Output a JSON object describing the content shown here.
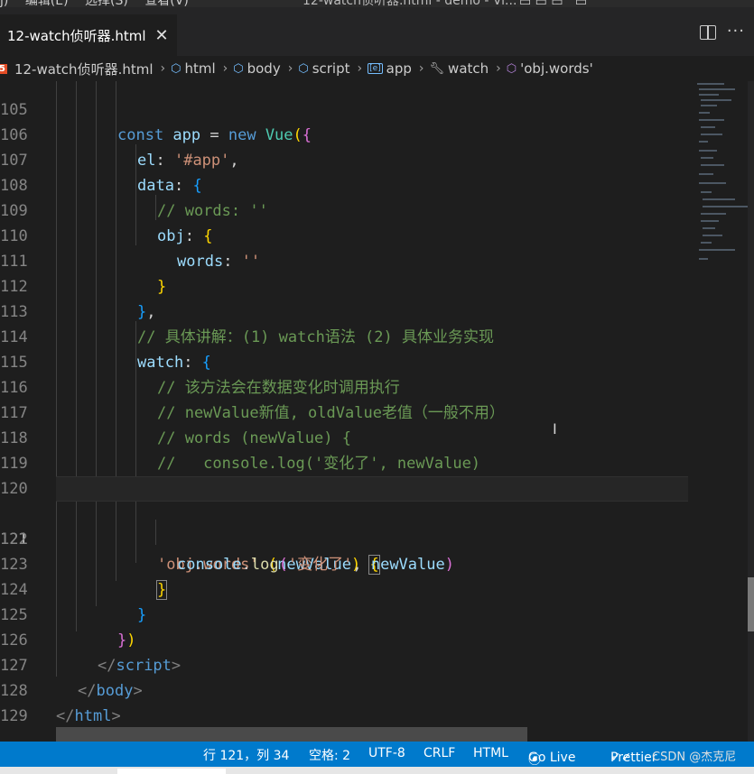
{
  "menubar": {
    "items": [
      "j)",
      "编辑(E)",
      "选择(S)",
      "查看(V)"
    ],
    "window_title": "12-watch侦听器.html - demo - Vi..."
  },
  "tab": {
    "label": "12-watch侦听器.html",
    "close": "✕"
  },
  "breadcrumb": {
    "file": "12-watch侦听器.html",
    "items": [
      "html",
      "body",
      "script",
      "app",
      "watch",
      "'obj.words'"
    ]
  },
  "editor": {
    "current_line": "121",
    "lines": [
      {
        "n": "105"
      },
      {
        "n": "106"
      },
      {
        "n": "107"
      },
      {
        "n": "108"
      },
      {
        "n": "109"
      },
      {
        "n": "110"
      },
      {
        "n": "111"
      },
      {
        "n": "112"
      },
      {
        "n": "113"
      },
      {
        "n": "114"
      },
      {
        "n": "115"
      },
      {
        "n": "116"
      },
      {
        "n": "117"
      },
      {
        "n": "118"
      },
      {
        "n": "119"
      },
      {
        "n": "120"
      },
      {
        "n": "121"
      },
      {
        "n": "122"
      },
      {
        "n": "123"
      },
      {
        "n": "124"
      },
      {
        "n": "125"
      },
      {
        "n": "126"
      },
      {
        "n": "127"
      },
      {
        "n": "128"
      },
      {
        "n": "129"
      }
    ],
    "tokens": {
      "l105": [
        "const",
        " app ",
        "=",
        " new ",
        "Vue",
        "(",
        "{"
      ],
      "l106": [
        "el",
        ": ",
        "'#app'",
        ","
      ],
      "l107": [
        "data",
        ": ",
        "{"
      ],
      "l108": [
        "// words: ''"
      ],
      "l109": [
        "obj",
        ": ",
        "{"
      ],
      "l110": [
        "words",
        ": ",
        "''"
      ],
      "l111": [
        "}"
      ],
      "l112": [
        "}",
        ","
      ],
      "l113": [
        "// 具体讲解：(1) watch语法 (2) 具体业务实现"
      ],
      "l114": [
        "watch",
        ": ",
        "{"
      ],
      "l115": [
        "// 该方法会在数据变化时调用执行"
      ],
      "l116": [
        "// newValue新值, oldValue老值（一般不用）"
      ],
      "l117": [
        "// words (newValue) {"
      ],
      "l118": [
        "//   console.log('变化了', newValue)"
      ],
      "l119": [
        "// }"
      ],
      "l121": [
        "'obj.words'",
        " ",
        "(",
        "newValue",
        ")",
        " ",
        "{"
      ],
      "l122": [
        "console",
        ".",
        "log",
        "(",
        "'变化了'",
        ", ",
        "newValue",
        ")"
      ],
      "l123": [
        "}"
      ],
      "l124": [
        "}"
      ],
      "l125": [
        "}",
        ")"
      ],
      "l126": [
        "</",
        "script",
        ">"
      ],
      "l127": [
        "</",
        "body",
        ">"
      ],
      "l128": [
        "</",
        "html",
        ">"
      ]
    }
  },
  "statusbar": {
    "position": "行 121，列 34",
    "spaces": "空格: 2",
    "encoding": "UTF-8",
    "eol": "CRLF",
    "language": "HTML",
    "golive": "Go Live",
    "prettier": "Prettier",
    "watermark": "CSDN @杰克尼"
  },
  "colors": {
    "accent": "#007acc",
    "keyword": "#569cd6",
    "string": "#ce9178",
    "comment": "#6a9955"
  }
}
